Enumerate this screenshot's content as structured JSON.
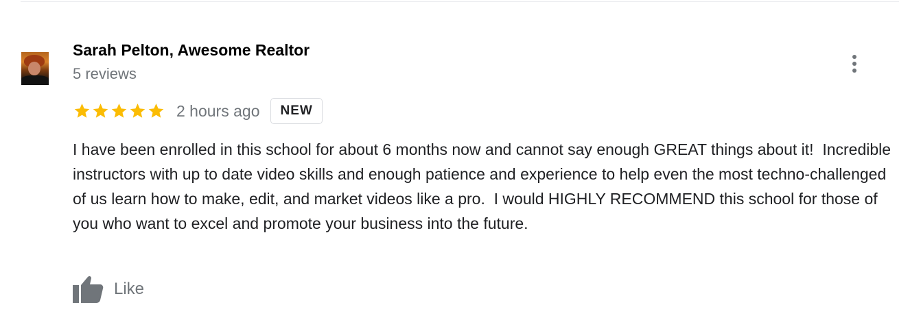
{
  "review": {
    "author_name": "Sarah Pelton, Awesome Realtor",
    "author_reviews": "5 reviews",
    "rating": 5,
    "max_rating": 5,
    "time_ago": "2 hours ago",
    "badge": "NEW",
    "text": "I have been enrolled in this school for about 6 months now and cannot say enough GREAT things about it!  Incredible instructors with up to date video skills and enough patience and experience to help even the most techno-challenged of us learn how to make, edit, and market videos like a pro.  I would HIGHLY RECOMMEND this school for those of you who want to excel and promote your business into the future.",
    "like_label": "Like"
  },
  "icons": {
    "star": "star-icon",
    "more": "more-vert-icon",
    "like": "thumb-up-icon"
  },
  "colors": {
    "star": "#fbbc04",
    "secondary_text": "#70757a",
    "primary_text": "#202124"
  }
}
